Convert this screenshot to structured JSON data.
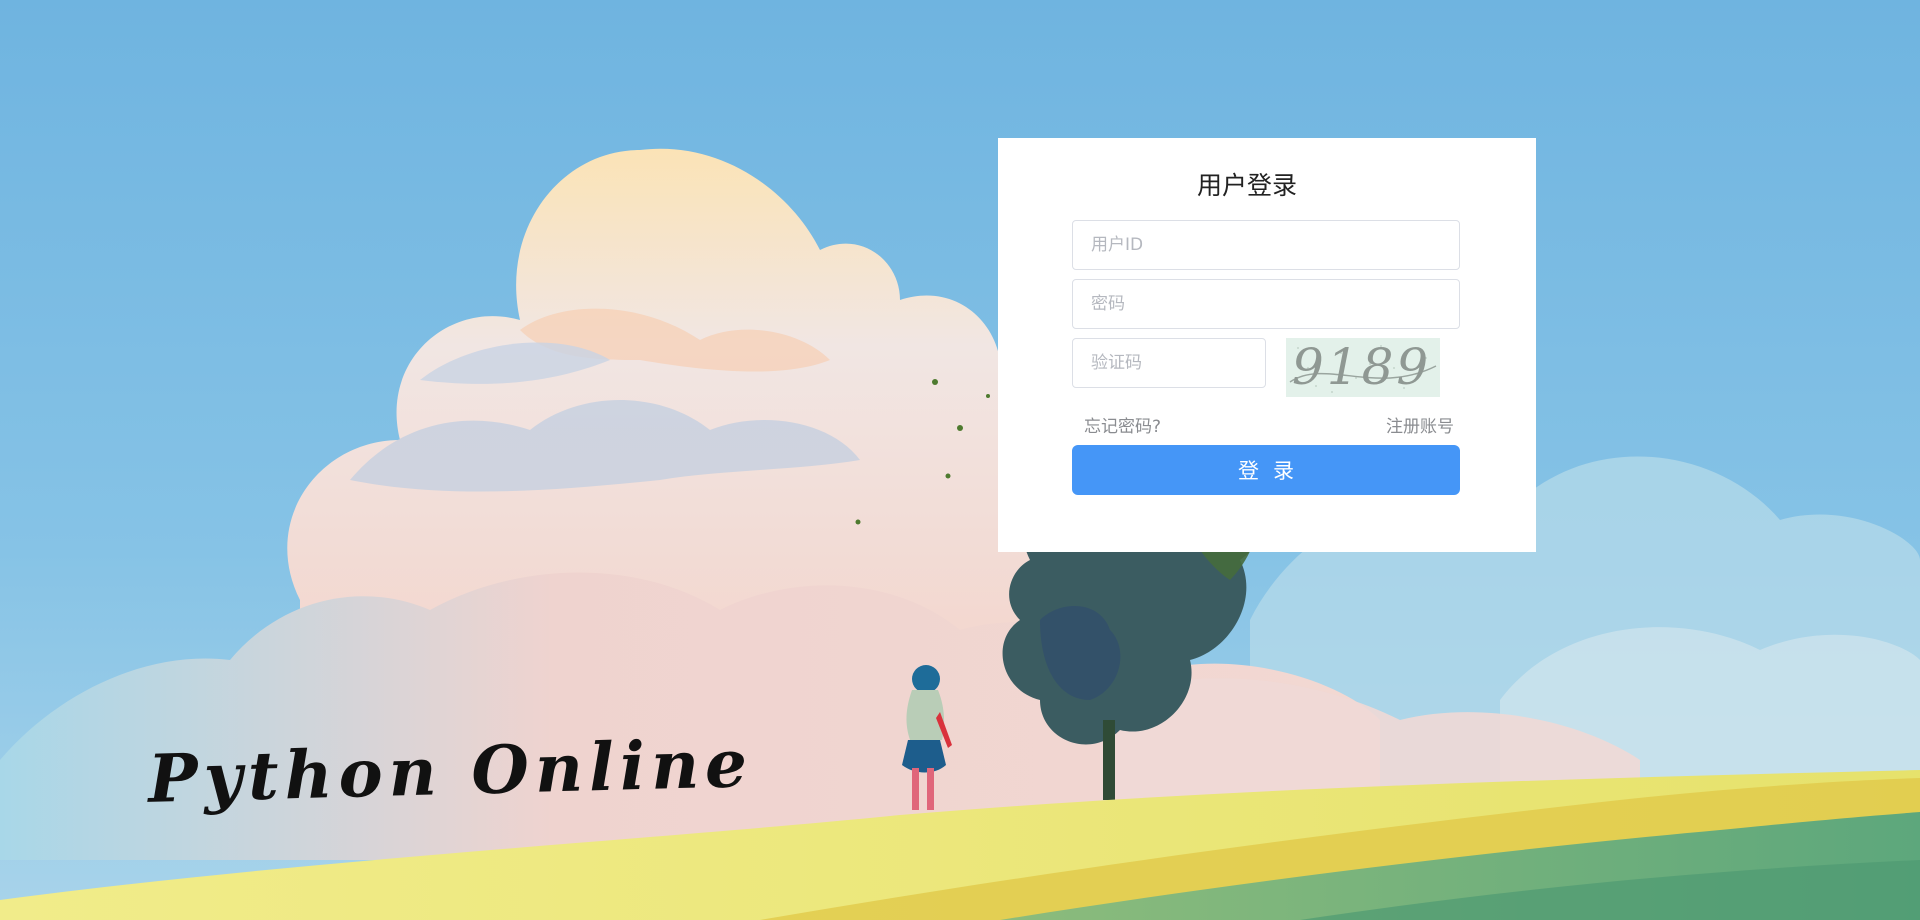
{
  "brand": {
    "text": "Python Online"
  },
  "login": {
    "title": "用户登录",
    "user_id_placeholder": "用户ID",
    "password_placeholder": "密码",
    "captcha_placeholder": "验证码",
    "captcha_code": "9189",
    "forgot_password_label": "忘记密码?",
    "register_label": "注册账号",
    "submit_label": "登录"
  },
  "colors": {
    "sky": "#74b8e2",
    "card_bg": "#ffffff",
    "button_bg": "#4596f7",
    "link_text": "#8a8c90",
    "grass_yellow": "#ecea78",
    "grass_green": "#6aa874"
  }
}
